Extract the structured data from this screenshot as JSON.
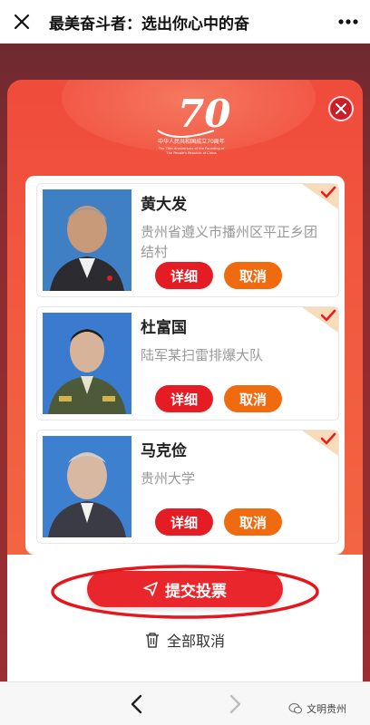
{
  "header": {
    "title": "最美奋斗者：选出你心中的奋"
  },
  "logo": {
    "caption_cn": "中华人民共和国成立70周年",
    "caption_en": "The 70th Anniversary of the Founding of The People's Republic of China",
    "number": "70"
  },
  "candidates": [
    {
      "name": "黄大发",
      "desc": "贵州省遵义市播州区平正乡团结村",
      "detail_label": "详细",
      "cancel_label": "取消"
    },
    {
      "name": "杜富国",
      "desc": "陆军某扫雷排爆大队",
      "detail_label": "详细",
      "cancel_label": "取消"
    },
    {
      "name": "马克俭",
      "desc": "贵州大学",
      "detail_label": "详细",
      "cancel_label": "取消"
    }
  ],
  "actions": {
    "submit_label": "提交投票",
    "cancel_all_label": "全部取消"
  },
  "watermark": {
    "text": "文明贵州"
  },
  "colors": {
    "primary_red": "#e61c24",
    "orange": "#f06a10",
    "modal_top": "#f04b3c"
  }
}
